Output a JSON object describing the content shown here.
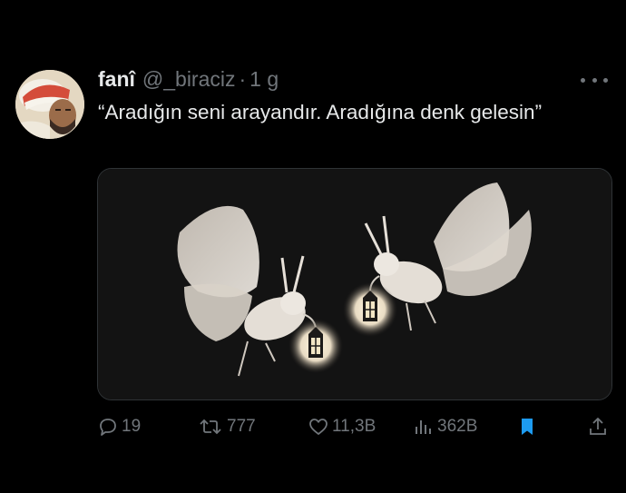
{
  "tweet": {
    "author_name": "fanî",
    "handle": "@_biraciz",
    "separator": "·",
    "time": "1 g",
    "text": "“Aradığın seni arayandır. Aradığına denk gelesin”"
  },
  "icons": {
    "more": "more-dots-icon",
    "reply": "reply-icon",
    "retweet": "retweet-icon",
    "like": "heart-icon",
    "views": "views-chart-icon",
    "bookmark": "bookmark-icon",
    "share": "share-icon"
  },
  "actions": {
    "replies": "19",
    "retweets": "777",
    "likes": "11,3B",
    "views": "362B"
  },
  "colors": {
    "background": "#000000",
    "text": "#e7e9ea",
    "secondary": "#71767b",
    "accent": "#1d9bf0"
  }
}
